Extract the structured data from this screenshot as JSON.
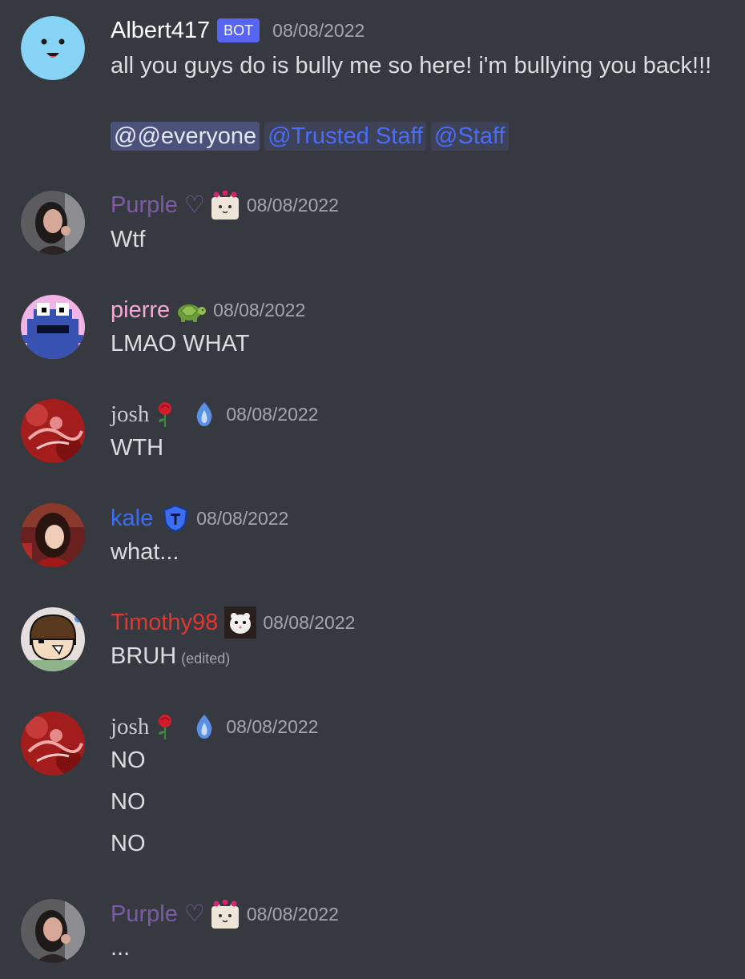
{
  "colors": {
    "background": "#36393f",
    "text": "#dcddde",
    "timestamp": "#a3a6aa",
    "bot_tag": "#5865f2"
  },
  "messages": [
    {
      "username": "Albert417",
      "name_color": "#ffffff",
      "bot_tag": "BOT",
      "timestamp": "08/08/2022",
      "lines": [
        "all you guys do is bully me so here! i'm bullying you back!!!"
      ],
      "mentions": [
        "@@everyone",
        "@Trusted Staff",
        "@Staff"
      ],
      "avatar_icon": "smiley-face-avatar"
    },
    {
      "username": "Purple",
      "name_color": "#7c5ba6",
      "name_suffix": "♡",
      "badge_icon": "cat-with-hearts-emote",
      "timestamp": "08/08/2022",
      "lines": [
        "Wtf"
      ],
      "avatar_icon": "photo-avatar"
    },
    {
      "username": "pierre",
      "name_color": "#f5a9d6",
      "badge_icon": "turtle-emote",
      "timestamp": "08/08/2022",
      "lines": [
        "LMAO WHAT"
      ],
      "avatar_icon": "pixel-monster-avatar"
    },
    {
      "username": "josh",
      "name_color": "#c9cdd3",
      "badge_icon": "rose-emote",
      "badge_icon_2": "blue-flame-emote",
      "timestamp": "08/08/2022",
      "lines": [
        "WTH"
      ],
      "avatar_icon": "red-art-avatar"
    },
    {
      "username": "kale",
      "name_color": "#3b6ef0",
      "badge_icon": "blue-shield-emote",
      "timestamp": "08/08/2022",
      "lines": [
        "what..."
      ],
      "avatar_icon": "anime-art-avatar"
    },
    {
      "username": "Timothy98",
      "name_color": "#e0382f",
      "badge_icon": "ferret-emote",
      "timestamp": "08/08/2022",
      "lines": [
        "BRUH"
      ],
      "edited": "(edited)",
      "avatar_icon": "cartoon-boy-avatar"
    },
    {
      "username": "josh",
      "name_color": "#c9cdd3",
      "badge_icon": "rose-emote",
      "badge_icon_2": "blue-flame-emote",
      "timestamp": "08/08/2022",
      "lines": [
        "NO",
        "NO",
        "NO"
      ],
      "avatar_icon": "red-art-avatar"
    },
    {
      "username": "Purple",
      "name_color": "#7c5ba6",
      "name_suffix": "♡",
      "badge_icon": "cat-with-hearts-emote",
      "timestamp": "08/08/2022",
      "lines": [
        "..."
      ],
      "avatar_icon": "photo-avatar"
    }
  ]
}
